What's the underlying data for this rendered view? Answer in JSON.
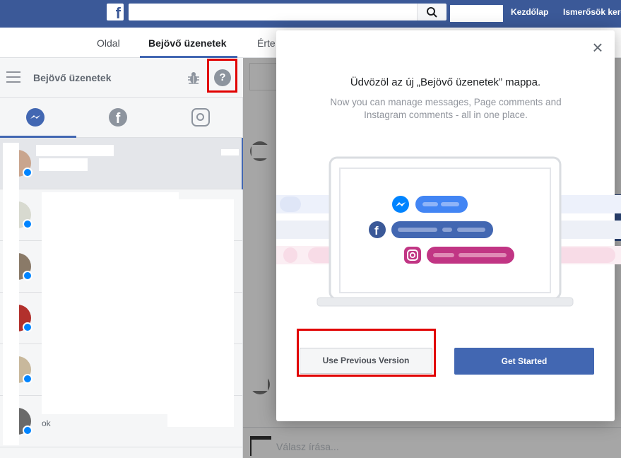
{
  "topbar": {
    "logo": "f",
    "nav": [
      "Kezdőlap",
      "Ismerősök kere"
    ]
  },
  "tabs": [
    "Oldal",
    "Bejövő üzenetek",
    "Érte"
  ],
  "inbox": {
    "title": "Bejövő üzenetek",
    "last_preview": "ok"
  },
  "modal": {
    "title": "Üdvözöl az új „Bejövő üzenetek” mappa.",
    "subtitle": "Now you can manage messages, Page comments and Instagram comments - all in one place.",
    "prev_button": "Use Previous Version",
    "start_button": "Get Started",
    "close": "×"
  },
  "reply": {
    "placeholder": "Válasz írása..."
  },
  "icons": {
    "search": "search-icon",
    "menu": "hamburger-icon",
    "bug": "bug-icon",
    "help": "question-icon",
    "messenger": "messenger-icon",
    "facebook": "facebook-icon",
    "instagram": "instagram-icon"
  },
  "colors": {
    "brand": "#3b5998",
    "accent": "#4267b2",
    "messenger": "#0084ff",
    "instagram": "#c13584",
    "highlight": "#e10000"
  }
}
